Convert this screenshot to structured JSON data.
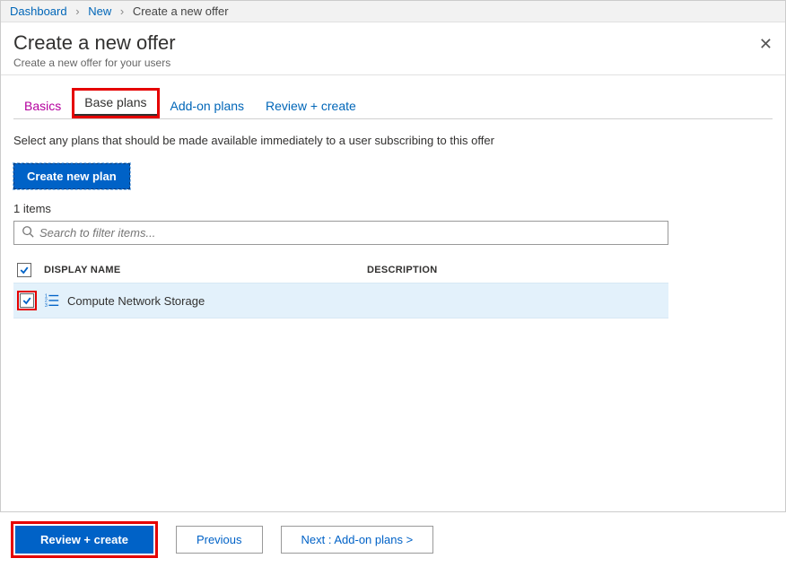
{
  "breadcrumb": {
    "items": [
      "Dashboard",
      "New"
    ],
    "current": "Create a new offer"
  },
  "header": {
    "title": "Create a new offer",
    "subtitle": "Create a new offer for your users"
  },
  "tabs": {
    "basics": "Basics",
    "base_plans": "Base plans",
    "addon_plans": "Add-on plans",
    "review": "Review + create"
  },
  "instruction": "Select any plans that should be made available immediately to a user subscribing to this offer",
  "create_plan_label": "Create new plan",
  "items_count": "1 items",
  "search": {
    "placeholder": "Search to filter items..."
  },
  "table": {
    "headers": {
      "display_name": "DISPLAY NAME",
      "description": "DESCRIPTION"
    },
    "rows": [
      {
        "display_name": "Compute Network Storage",
        "description": ""
      }
    ]
  },
  "footer": {
    "review": "Review + create",
    "previous": "Previous",
    "next": "Next : Add-on plans >"
  }
}
